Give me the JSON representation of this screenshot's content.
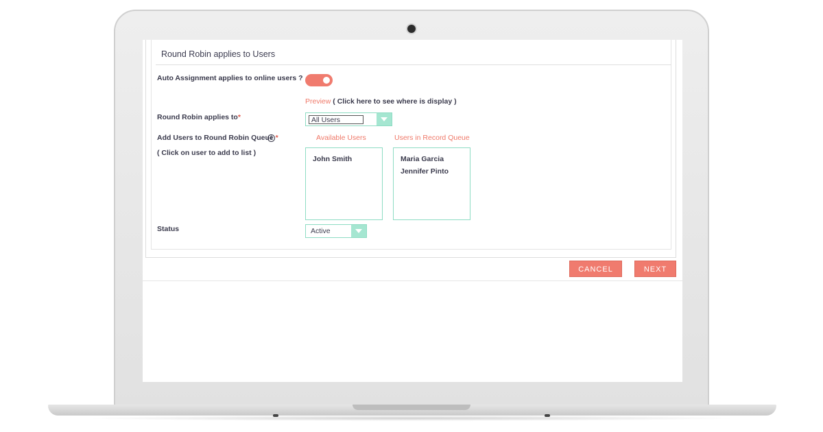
{
  "section": {
    "title": "Round Robin applies to Users"
  },
  "fields": {
    "auto_assignment_label": "Auto Assignment applies to online users ?",
    "auto_assignment_on": true,
    "preview_link": "Preview",
    "preview_hint": "( Click here to see where is display )",
    "applies_to_label": "Round Robin applies to",
    "required_mark": "*",
    "applies_to_value": "All Users",
    "queue_label": "Add Users to Round Robin Queue",
    "queue_required_mark": "*",
    "queue_hint": "( Click on user to add to list )",
    "info_glyph": "i",
    "status_label": "Status",
    "status_value": "Active"
  },
  "lists": {
    "available_header": "Available Users",
    "available_users": [
      "John Smith"
    ],
    "queue_header": "Users in Record Queue",
    "queue_users": [
      "Maria Garcia",
      "Jennifer Pinto"
    ]
  },
  "buttons": {
    "cancel": "CANCEL",
    "next": "NEXT"
  },
  "colors": {
    "accent": "#f07b6e",
    "teal_border": "#8ddcc3",
    "teal_fill": "#a5e6d1"
  },
  "icons": {
    "info": "info-icon",
    "dropdown": "chevron-down-icon"
  }
}
